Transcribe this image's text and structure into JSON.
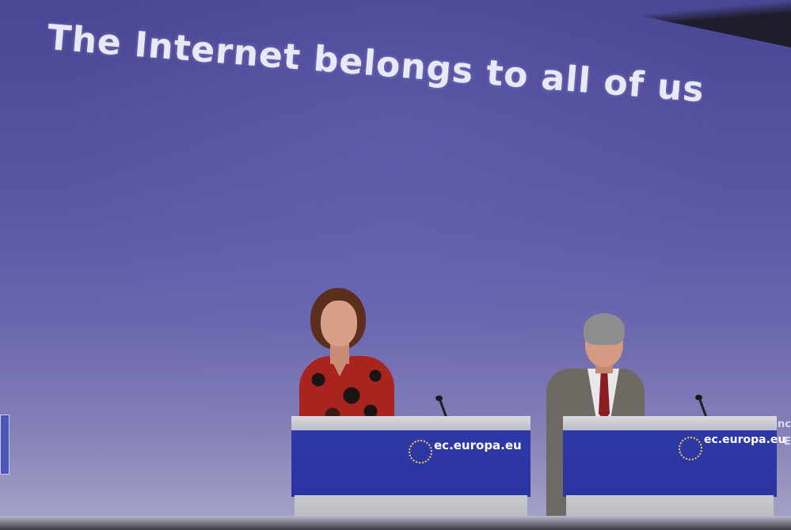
{
  "screen": {
    "headline": "The Internet belongs to all of us",
    "edge_text_line1": "genc",
    "edge_text_line2": "E"
  },
  "podiums": {
    "left_url": "ec.europa.eu",
    "right_url": "ec.europa.eu"
  },
  "colors": {
    "screen_blue": "#5954a3",
    "podium_blue": "#2f39a5",
    "headline_text": "#e8e9f6",
    "eu_star_yellow": "#f6d34a"
  }
}
